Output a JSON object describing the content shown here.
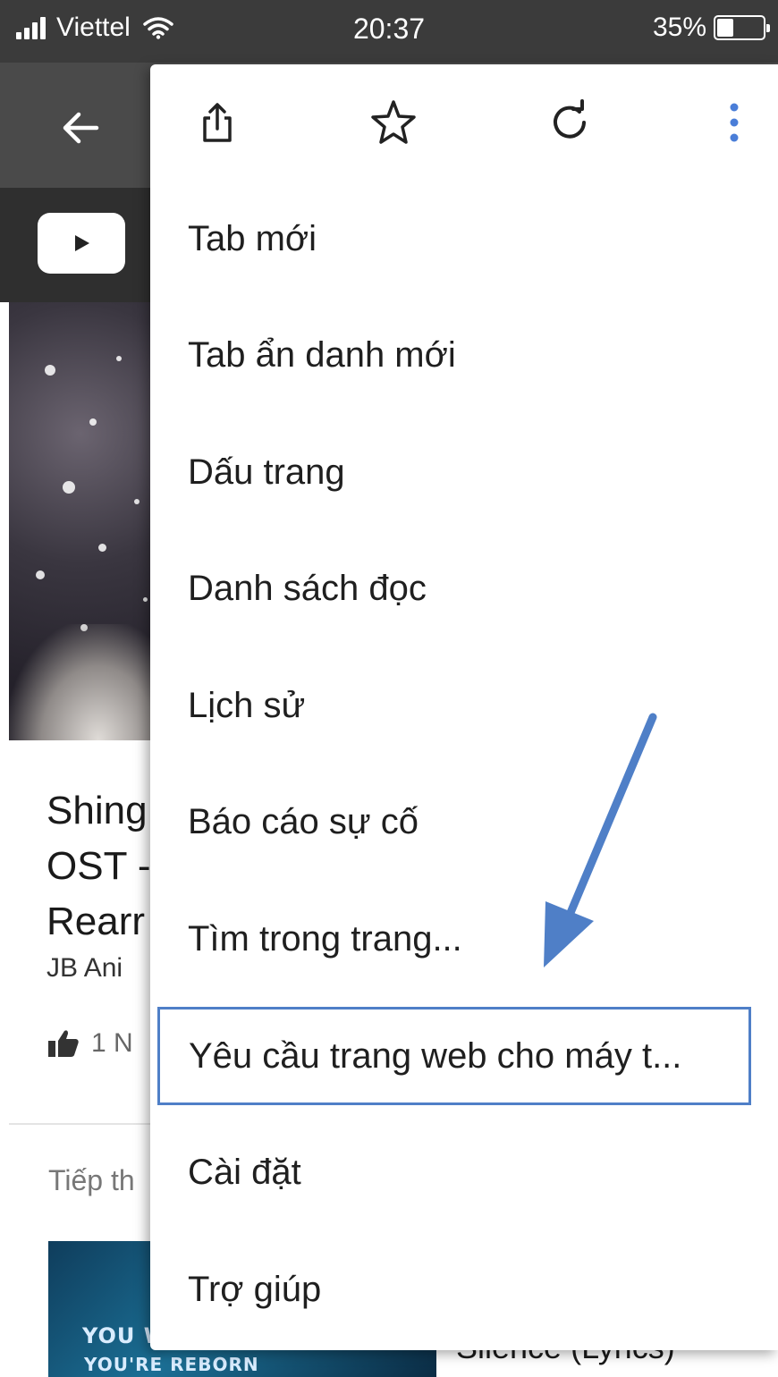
{
  "status_bar": {
    "carrier": "Viettel",
    "time": "20:37",
    "battery": "35%",
    "battery_level": 0.35
  },
  "toolbar": {
    "back_icon": "arrow-left-icon"
  },
  "youtube": {
    "logo_icon": "youtube-play-icon"
  },
  "video": {
    "title": "Shing\nOST -\nRearr",
    "channel": "JB Ani",
    "likes": "1 N",
    "up_next": "Tiếp th"
  },
  "next_video": {
    "thumb_line1": "YOU W",
    "thumb_line2": "YOU'RE REBORN",
    "title": "Silence (Lyrics)"
  },
  "menu": {
    "toolbar_icons": [
      "share-icon",
      "star-icon",
      "reload-icon",
      "more-vertical-icon"
    ],
    "items": [
      {
        "label": "Tab mới"
      },
      {
        "label": "Tab ẩn danh mới"
      },
      {
        "label": "Dấu trang"
      },
      {
        "label": "Danh sách đọc"
      },
      {
        "label": "Lịch sử"
      },
      {
        "label": "Báo cáo sự cố"
      },
      {
        "label": "Tìm trong trang..."
      },
      {
        "label": "Yêu cầu trang web cho máy t..."
      },
      {
        "label": "Cài đặt"
      },
      {
        "label": "Trợ giúp"
      }
    ],
    "highlight_color": "#4f7fc7",
    "accent_color": "#4a7ed8"
  },
  "annotation": {
    "arrow_color": "#4f7fc7"
  }
}
